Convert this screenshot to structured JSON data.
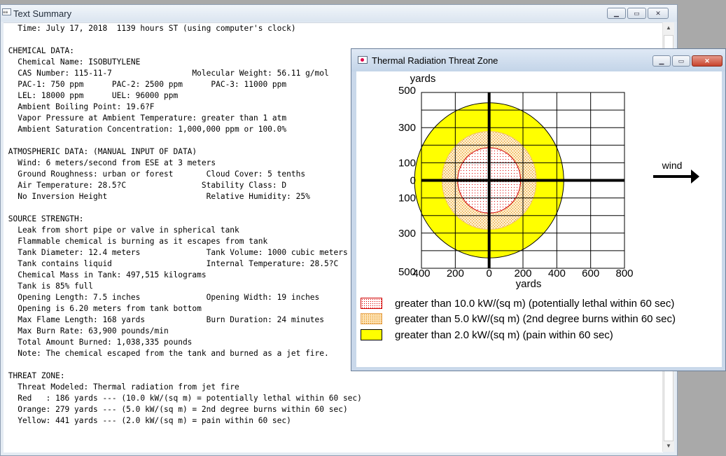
{
  "text_summary": {
    "title": "Text Summary",
    "lines": [
      "   Time: July 17, 2018  1139 hours ST (using computer's clock)",
      "",
      " CHEMICAL DATA:",
      "   Chemical Name: ISOBUTYLENE",
      "   CAS Number: 115-11-7                 Molecular Weight: 56.11 g/mol",
      "   PAC-1: 750 ppm      PAC-2: 2500 ppm      PAC-3: 11000 ppm",
      "   LEL: 18000 ppm      UEL: 96000 ppm",
      "   Ambient Boiling Point: 19.6?F",
      "   Vapor Pressure at Ambient Temperature: greater than 1 atm",
      "   Ambient Saturation Concentration: 1,000,000 ppm or 100.0%",
      "",
      " ATMOSPHERIC DATA: (MANUAL INPUT OF DATA)",
      "   Wind: 6 meters/second from ESE at 3 meters",
      "   Ground Roughness: urban or forest       Cloud Cover: 5 tenths",
      "   Air Temperature: 28.5?C                Stability Class: D",
      "   No Inversion Height                     Relative Humidity: 25%",
      "",
      " SOURCE STRENGTH:",
      "   Leak from short pipe or valve in spherical tank",
      "   Flammable chemical is burning as it escapes from tank",
      "   Tank Diameter: 12.4 meters              Tank Volume: 1000 cubic meters",
      "   Tank contains liquid                    Internal Temperature: 28.5?C",
      "   Chemical Mass in Tank: 497,515 kilograms",
      "   Tank is 85% full",
      "   Opening Length: 7.5 inches              Opening Width: 19 inches",
      "   Opening is 6.20 meters from tank bottom",
      "   Max Flame Length: 168 yards             Burn Duration: 24 minutes",
      "   Max Burn Rate: 63,900 pounds/min",
      "   Total Amount Burned: 1,038,335 pounds",
      "   Note: The chemical escaped from the tank and burned as a jet fire.",
      "",
      " THREAT ZONE:",
      "   Threat Modeled: Thermal radiation from jet fire",
      "   Red   : 186 yards --- (10.0 kW/(sq m) = potentially lethal within 60 sec)",
      "   Orange: 279 yards --- (5.0 kW/(sq m) = 2nd degree burns within 60 sec)",
      "   Yellow: 441 yards --- (2.0 kW/(sq m) = pain within 60 sec)"
    ]
  },
  "threat_window": {
    "title": "Thermal Radiation Threat Zone",
    "legend": [
      {
        "label": "greater than 10.0 kW/(sq m) (potentially lethal within 60 sec)",
        "color": "#ff0000",
        "pattern": "dotted-red"
      },
      {
        "label": "greater than 5.0 kW/(sq m) (2nd degree burns within 60 sec)",
        "color": "#f5b041",
        "pattern": "dotted-orange"
      },
      {
        "label": "greater than 2.0 kW/(sq m) (pain within 60 sec)",
        "color": "#ffff00",
        "pattern": "solid-yellow"
      }
    ]
  },
  "chart_data": {
    "type": "area",
    "units": "yards",
    "xlabel": "yards",
    "ylabel": "yards",
    "xlim": [
      -400,
      800
    ],
    "ylim": [
      -500,
      500
    ],
    "x_tick_labels": [
      "400",
      "200",
      "0",
      "200",
      "400",
      "600",
      "800"
    ],
    "y_tick_labels": [
      "500",
      "300",
      "100",
      "0",
      "100",
      "300",
      "500"
    ],
    "wind_label": "wind",
    "zones": [
      {
        "name": "Yellow",
        "radius": 441,
        "color": "#ffff00"
      },
      {
        "name": "Orange",
        "radius": 279,
        "color": "#f5b041"
      },
      {
        "name": "Red",
        "radius": 186,
        "color": "#e00000"
      }
    ]
  }
}
